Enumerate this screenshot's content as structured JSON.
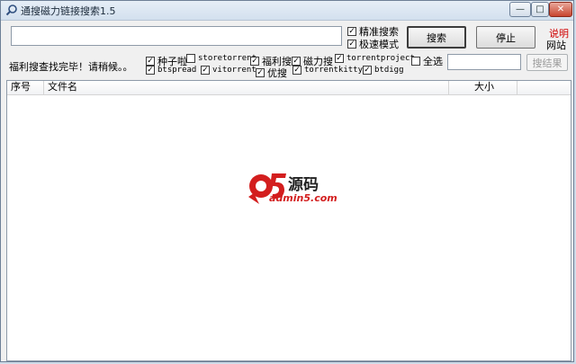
{
  "window": {
    "title": "通搜磁力链接搜索1.5",
    "controls": {
      "minimize": "—",
      "maximize": "□",
      "close": "✕"
    }
  },
  "search": {
    "value": "",
    "placeholder": ""
  },
  "options": {
    "exact": {
      "label": "精准搜索",
      "checked": true
    },
    "fast": {
      "label": "极速模式",
      "checked": true
    }
  },
  "buttons": {
    "search": "搜索",
    "stop": "停止",
    "filter_results": "搜结果"
  },
  "links": {
    "help": "说明",
    "site": "网站"
  },
  "status": "福利搜查找完毕！请稍候。。",
  "sources_row1": [
    {
      "label": "种子啦",
      "checked": true,
      "mono": false
    },
    {
      "label": "storetorrent",
      "checked": false,
      "mono": true
    },
    {
      "label": "福利搜",
      "checked": true,
      "mono": false
    },
    {
      "label": "磁力搜",
      "checked": true,
      "mono": false
    },
    {
      "label": "torrentproject",
      "checked": true,
      "mono": true
    },
    {
      "label": "全选",
      "checked": false,
      "mono": false
    }
  ],
  "sources_row2": [
    {
      "label": "btspread",
      "checked": true,
      "mono": true
    },
    {
      "label": "vitorrent",
      "checked": true,
      "mono": true
    },
    {
      "label": "优搜",
      "checked": true,
      "mono": false
    },
    {
      "label": "torrentkitty",
      "checked": true,
      "mono": true
    },
    {
      "label": "btdigg",
      "checked": true,
      "mono": true
    }
  ],
  "results_filter": {
    "value": ""
  },
  "table": {
    "columns": [
      "序号",
      "文件名",
      "大小"
    ],
    "rows": []
  },
  "watermark": {
    "brand": "源码",
    "domain": "admin5.com",
    "logo_letters": "a5"
  },
  "colors": {
    "link_red": "#d00000",
    "logo_red": "#d31e1e"
  }
}
